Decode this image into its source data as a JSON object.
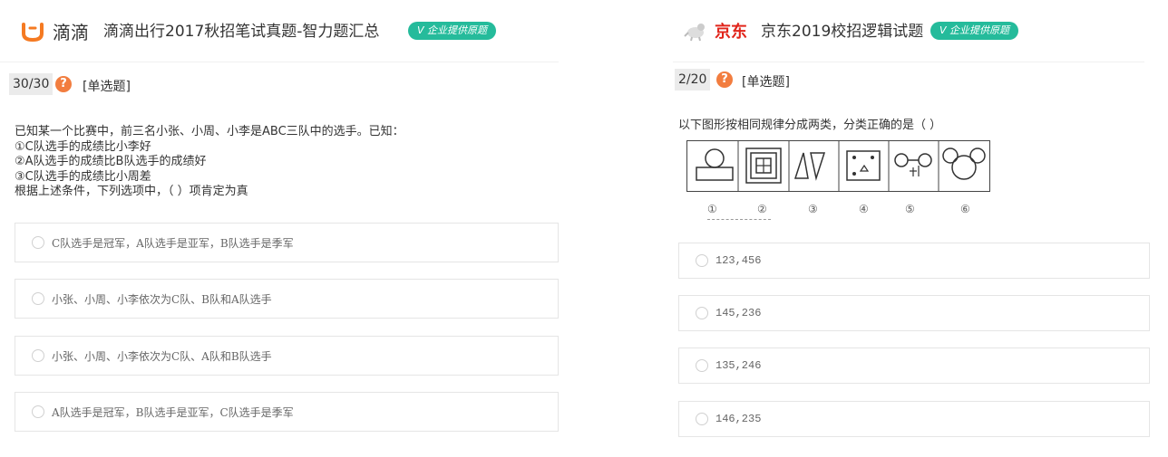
{
  "left": {
    "brand_name": "滴滴",
    "title": "滴滴出行2017秋招笔试真题-智力题汇总",
    "badge": "V 企业提供原题",
    "question_number": "30/30",
    "help_symbol": "?",
    "question_type": "[单选题]",
    "stem_lines": [
      "已知某一个比赛中，前三名小张、小周、小李是ABC三队中的选手。已知：",
      "①C队选手的成绩比小李好",
      "②A队选手的成绩比B队选手的成绩好",
      "③C队选手的成绩比小周差",
      "根据上述条件，下列选项中，（ ）项肯定为真"
    ],
    "options": [
      "C队选手是冠军，A队选手是亚军，B队选手是季军",
      "小张、小周、小李依次为C队、B队和A队选手",
      "小张、小周、小李依次为C队、A队和B队选手",
      "A队选手是冠军，B队选手是亚军，C队选手是季军"
    ]
  },
  "right": {
    "brand_name": "京东",
    "title": "京东2019校招逻辑试题",
    "badge": "V 企业提供原题",
    "question_number": "2/20",
    "help_symbol": "?",
    "question_type": "[单选题]",
    "stem": "以下图形按相同规律分成两类，分类正确的是（ ）",
    "figure_labels": [
      "①",
      "②",
      "③",
      "④",
      "⑤",
      "⑥"
    ],
    "options": [
      "123,456",
      "145,236",
      "135,246",
      "146,235"
    ]
  },
  "colors": {
    "didi_orange": "#f57a22",
    "jd_red": "#e1251b",
    "badge_green": "#25bb9b",
    "help_orange": "#f27d3f"
  }
}
